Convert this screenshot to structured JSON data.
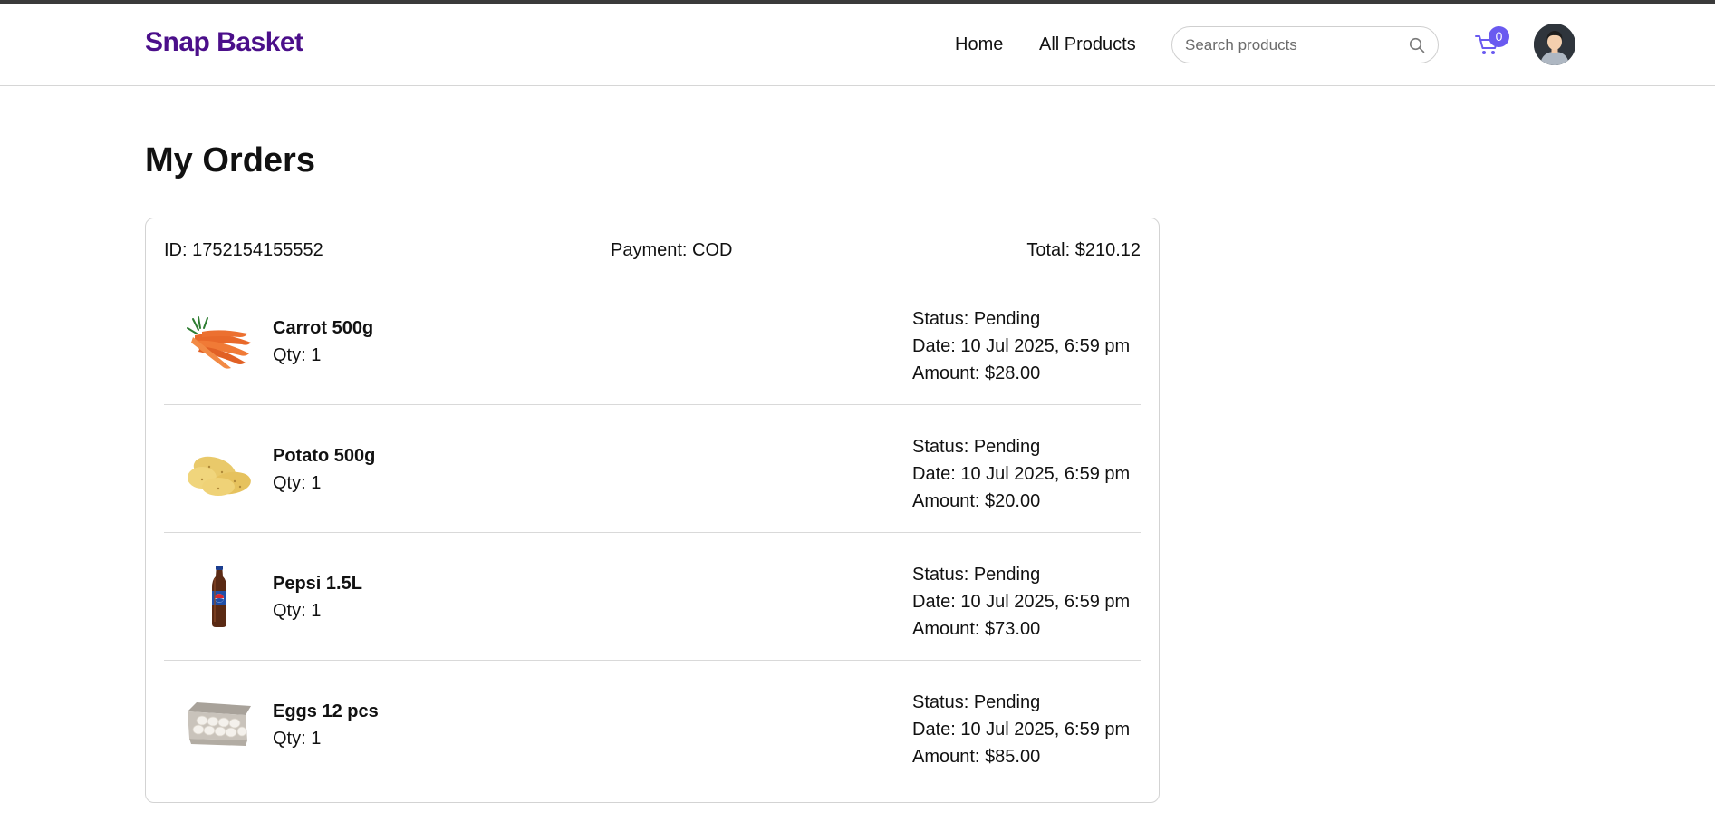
{
  "header": {
    "brand": "Snap Basket",
    "nav": {
      "home": "Home",
      "all_products": "All Products"
    },
    "search": {
      "placeholder": "Search products",
      "value": ""
    },
    "cart_count": "0",
    "icons": {
      "search": "search-icon",
      "cart": "cart-icon",
      "avatar": "user-avatar"
    },
    "colors": {
      "brand": "#4b0f8a",
      "accent": "#6a5af0"
    }
  },
  "page": {
    "title": "My Orders"
  },
  "order": {
    "id_text": "ID: 1752154155552",
    "payment_text": "Payment: COD",
    "total_text": "Total: $210.12",
    "items": [
      {
        "name": "Carrot 500g",
        "qty": "Qty: 1",
        "status": "Status: Pending",
        "date": "Date: 10 Jul 2025, 6:59 pm",
        "amount": "Amount: $28.00",
        "image": "carrot"
      },
      {
        "name": "Potato 500g",
        "qty": "Qty: 1",
        "status": "Status: Pending",
        "date": "Date: 10 Jul 2025, 6:59 pm",
        "amount": "Amount: $20.00",
        "image": "potato"
      },
      {
        "name": "Pepsi 1.5L",
        "qty": "Qty: 1",
        "status": "Status: Pending",
        "date": "Date: 10 Jul 2025, 6:59 pm",
        "amount": "Amount: $73.00",
        "image": "pepsi-bottle"
      },
      {
        "name": "Eggs 12 pcs",
        "qty": "Qty: 1",
        "status": "Status: Pending",
        "date": "Date: 10 Jul 2025, 6:59 pm",
        "amount": "Amount: $85.00",
        "image": "egg-carton"
      }
    ]
  }
}
